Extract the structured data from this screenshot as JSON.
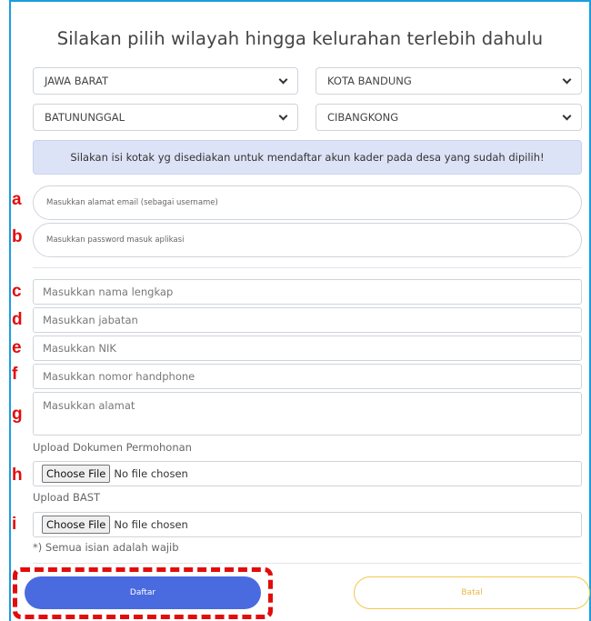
{
  "title": "Silakan pilih wilayah hingga kelurahan terlebih dahulu",
  "region": {
    "province": "JAWA BARAT",
    "city": "KOTA BANDUNG",
    "district": "BATUNUNGGAL",
    "village": "CIBANGKONG"
  },
  "alert_text": "Silakan isi kotak yg disediakan untuk mendaftar akun kader pada desa yang sudah dipilih!",
  "fields": {
    "email_placeholder": "Masukkan alamat email (sebagai username)",
    "password_placeholder": "Masukkan password masuk aplikasi",
    "name_placeholder": "Masukkan nama lengkap",
    "position_placeholder": "Masukkan jabatan",
    "nik_placeholder": "Masukkan NIK",
    "phone_placeholder": "Masukkan nomor handphone",
    "address_placeholder": "Masukkan alamat"
  },
  "uploads": {
    "doc_label": "Upload Dokumen Permohonan",
    "bast_label": "Upload BAST",
    "choose_file": "Choose File",
    "no_file": "No file chosen"
  },
  "note": "*) Semua isian adalah wajib",
  "buttons": {
    "register": "Daftar",
    "cancel": "Batal"
  },
  "markers": [
    "a",
    "b",
    "c",
    "d",
    "e",
    "f",
    "g",
    "h",
    "i"
  ],
  "colors": {
    "primary": "#4a6ae0",
    "cancel_border": "#f2c94c",
    "annotation": "#e30b0b",
    "frame": "#1a9ee0"
  }
}
